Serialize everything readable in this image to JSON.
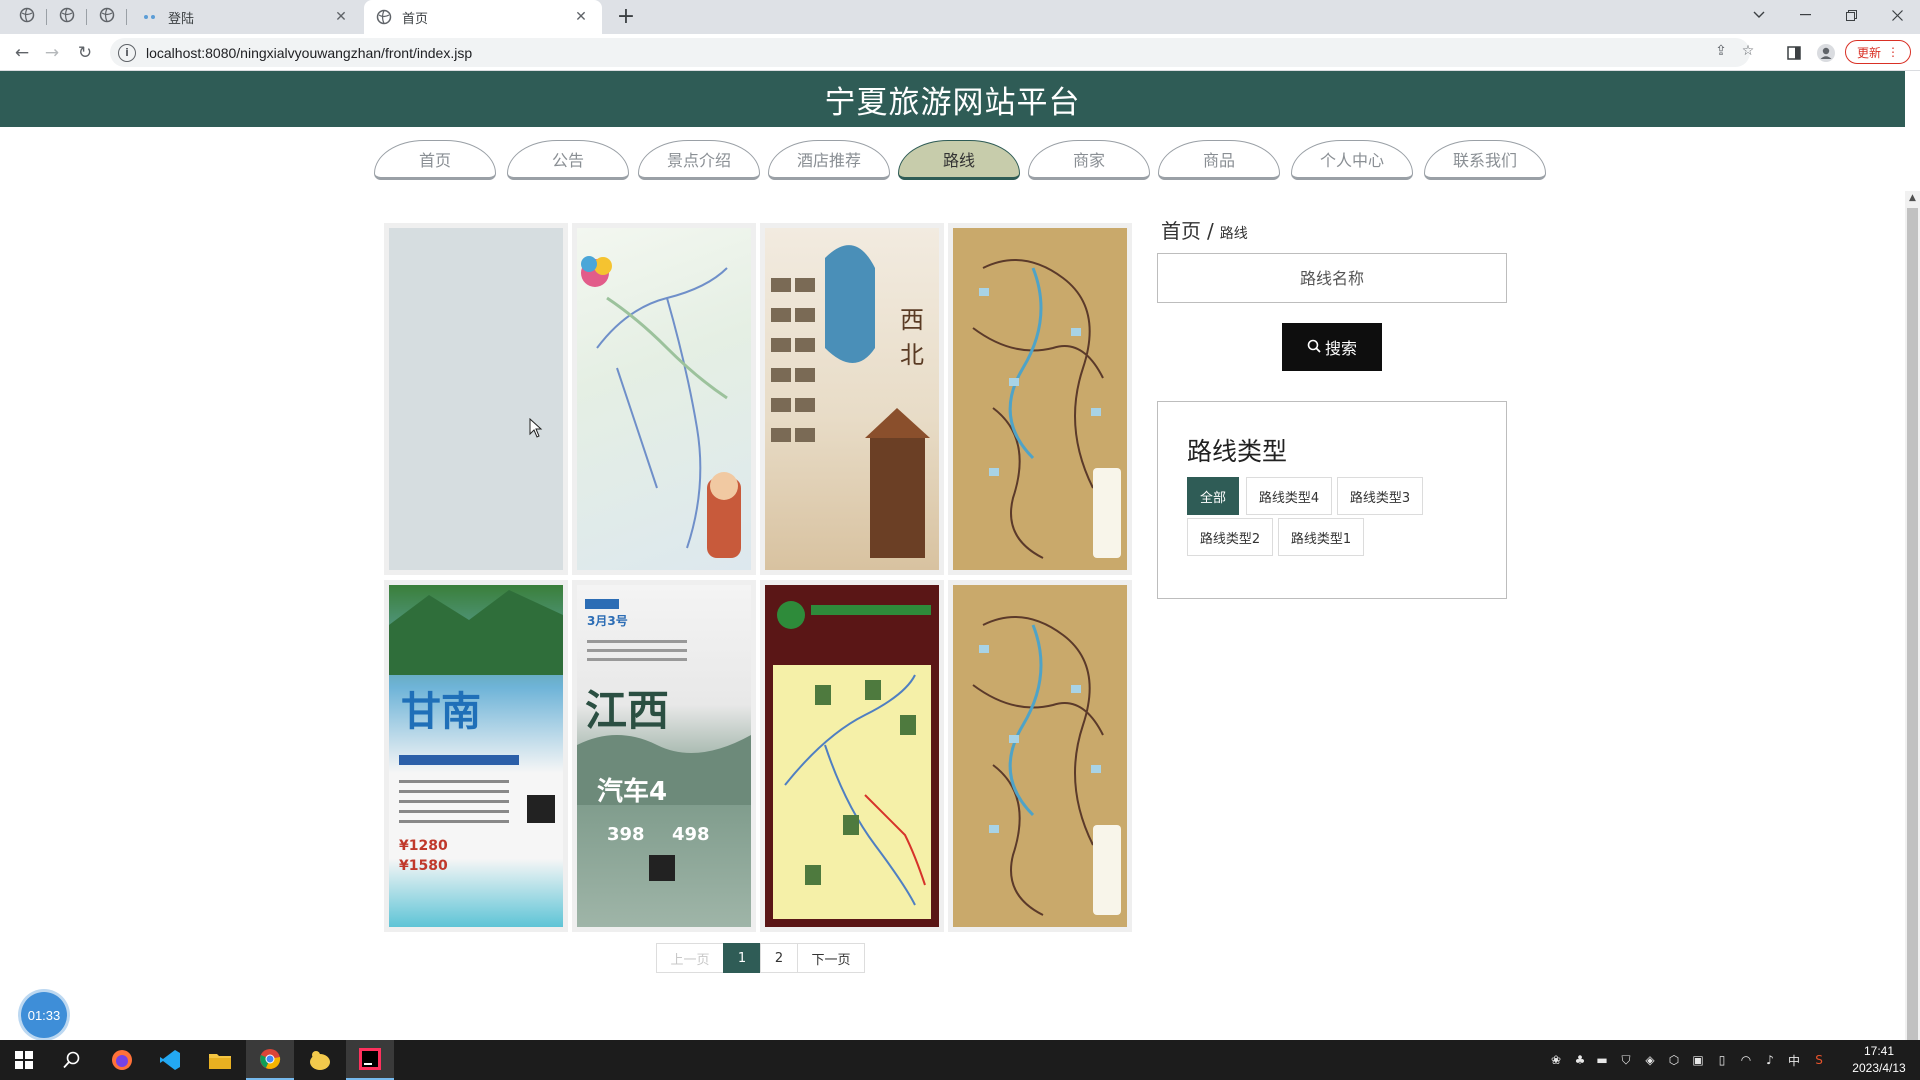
{
  "browser": {
    "tabs": [
      {
        "title": "登陆",
        "active": false
      },
      {
        "title": "首页",
        "active": true
      }
    ],
    "url": "localhost:8080/ningxialvyouwangzhan/front/index.jsp",
    "update_label": "更新"
  },
  "site": {
    "title": "宁夏旅游网站平台",
    "nav": [
      {
        "label": "首页",
        "active": false
      },
      {
        "label": "公告",
        "active": false
      },
      {
        "label": "景点介绍",
        "active": false
      },
      {
        "label": "酒店推荐",
        "active": false
      },
      {
        "label": "路线",
        "active": true
      },
      {
        "label": "商家",
        "active": false
      },
      {
        "label": "商品",
        "active": false
      },
      {
        "label": "个人中心",
        "active": false
      },
      {
        "label": "联系我们",
        "active": false
      }
    ]
  },
  "gallery": {
    "cards": [
      {
        "image": "blank-placeholder"
      },
      {
        "image": "route-map-green"
      },
      {
        "image": "northwest-poster"
      },
      {
        "image": "route-network-map"
      },
      {
        "image": "gannan-jiuzhai-poster"
      },
      {
        "image": "jiangxi-longhu-poster"
      },
      {
        "image": "scenic-area-route-map"
      },
      {
        "image": "route-network-map"
      }
    ]
  },
  "pagination": {
    "prev": "上一页",
    "pages": [
      "1",
      "2"
    ],
    "current": "1",
    "next": "下一页"
  },
  "sidebar": {
    "breadcrumb_home": "首页",
    "breadcrumb_sep": "/",
    "breadcrumb_current": "路线",
    "search_placeholder": "路线名称",
    "search_button": "搜索",
    "type_title": "路线类型",
    "types": [
      {
        "label": "全部",
        "active": true
      },
      {
        "label": "路线类型4",
        "active": false
      },
      {
        "label": "路线类型3",
        "active": false
      },
      {
        "label": "路线类型2",
        "active": false
      },
      {
        "label": "路线类型1",
        "active": false
      }
    ]
  },
  "recording_timer": "01:33",
  "taskbar": {
    "time": "17:41",
    "date": "2023/4/13",
    "ime": "中"
  },
  "colors": {
    "header": "#2f5c56",
    "nav_active": "#c7ccab",
    "search_button": "#0e0e0e",
    "page_current": "#2f5c56"
  }
}
